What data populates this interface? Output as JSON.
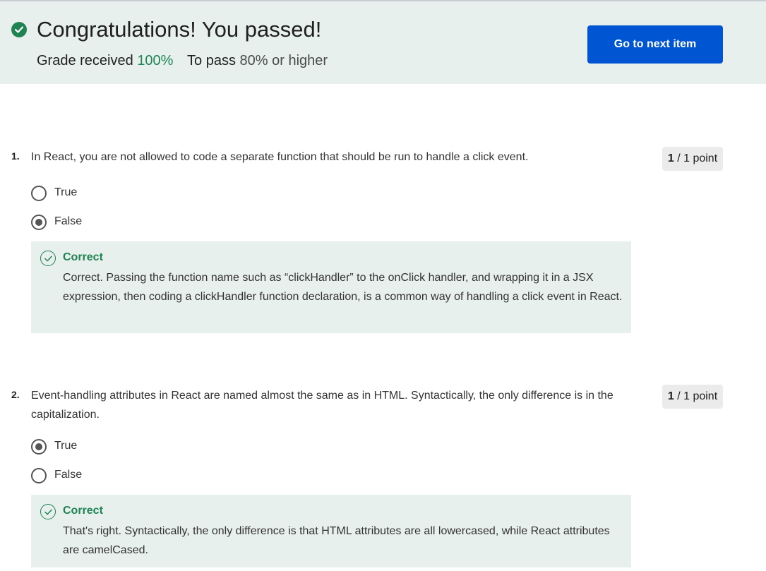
{
  "banner": {
    "title": "Congratulations! You passed!",
    "grade_label": "Grade received",
    "grade_value": "100%",
    "pass_label": "To pass",
    "pass_value": "80% or higher",
    "next_button": "Go to next item",
    "accent_color": "#1f8354",
    "button_color": "#0056d2"
  },
  "questions": [
    {
      "number": "1.",
      "text": "In React, you are not allowed to code a separate function that should be run to handle a click event.",
      "points_earned": "1",
      "points_suffix": "/ 1 point",
      "options": [
        {
          "label": "True",
          "selected": false
        },
        {
          "label": "False",
          "selected": true
        }
      ],
      "feedback": {
        "title": "Correct",
        "text": "Correct. Passing the function name such as “clickHandler” to the onClick handler, and wrapping it in a JSX expression, then coding a clickHandler function declaration, is a common way of handling a click event in React."
      }
    },
    {
      "number": "2.",
      "text": "Event-handling attributes in React are named almost the same as in HTML. Syntactically, the only difference is in the capitalization.",
      "points_earned": "1",
      "points_suffix": "/ 1 point",
      "options": [
        {
          "label": "True",
          "selected": true
        },
        {
          "label": "False",
          "selected": false
        }
      ],
      "feedback": {
        "title": "Correct",
        "text": "That's right. Syntactically, the only difference is that HTML attributes are all lowercased, while React attributes are camelCased."
      }
    }
  ]
}
